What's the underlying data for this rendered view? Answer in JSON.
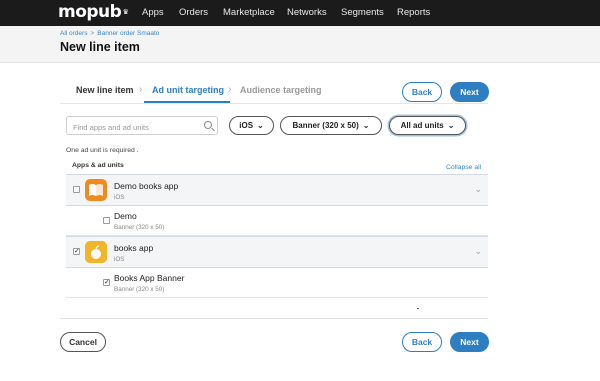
{
  "nav": {
    "logo": "mopub",
    "items": [
      "Apps",
      "Orders",
      "Marketplace",
      "Networks",
      "Segments",
      "Reports"
    ]
  },
  "header": {
    "breadcrumb": [
      "All orders",
      "Banner order Smaato"
    ],
    "title": "New line item"
  },
  "steps": [
    "New line item",
    "Ad unit targeting",
    "Audience targeting"
  ],
  "buttons": {
    "back": "Back",
    "next": "Next",
    "cancel": "Cancel"
  },
  "filters": {
    "search_placeholder": "Find apps and ad units",
    "platform": "iOS",
    "format": "Banner (320 x 50)",
    "scope": "All ad units"
  },
  "required_text": "One ad unit is required .",
  "list": {
    "header": "Apps & ad units",
    "collapse_all": "Collapse all",
    "apps": [
      {
        "name": "Demo books app",
        "platform": "iOS",
        "checked": false,
        "units": [
          {
            "name": "Demo",
            "format": "Banner (320 x 50)",
            "checked": false
          }
        ]
      },
      {
        "name": "books app",
        "platform": "iOS",
        "checked": true,
        "units": [
          {
            "name": "Books App Banner",
            "format": "Banner (320 x 50)",
            "checked": true
          }
        ]
      }
    ]
  },
  "colors": {
    "accent": "#2d7fc1",
    "topbar": "#1b1b1b",
    "app_icon_1": "#f08a1f",
    "app_icon_2": "#f0b528"
  }
}
